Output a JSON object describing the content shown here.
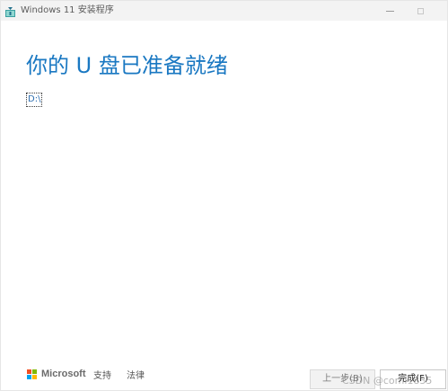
{
  "titlebar": {
    "title": "Windows 11 安装程序",
    "app_icon": "setup-app-icon"
  },
  "main": {
    "heading": "你的 U 盘已准备就绪",
    "drive_label": "D:\\"
  },
  "footer": {
    "brand": "Microsoft",
    "support_link": "支持",
    "legal_link": "法律",
    "back_button": "上一步(B)",
    "finish_button": "完成(F)",
    "watermark": "CSDN @coml1835"
  },
  "colors": {
    "heading": "#1a78c2",
    "titlebar_bg": "#f3f3f3",
    "ms_red": "#f25022",
    "ms_green": "#7fba00",
    "ms_blue": "#00a4ef",
    "ms_yellow": "#ffb900"
  }
}
